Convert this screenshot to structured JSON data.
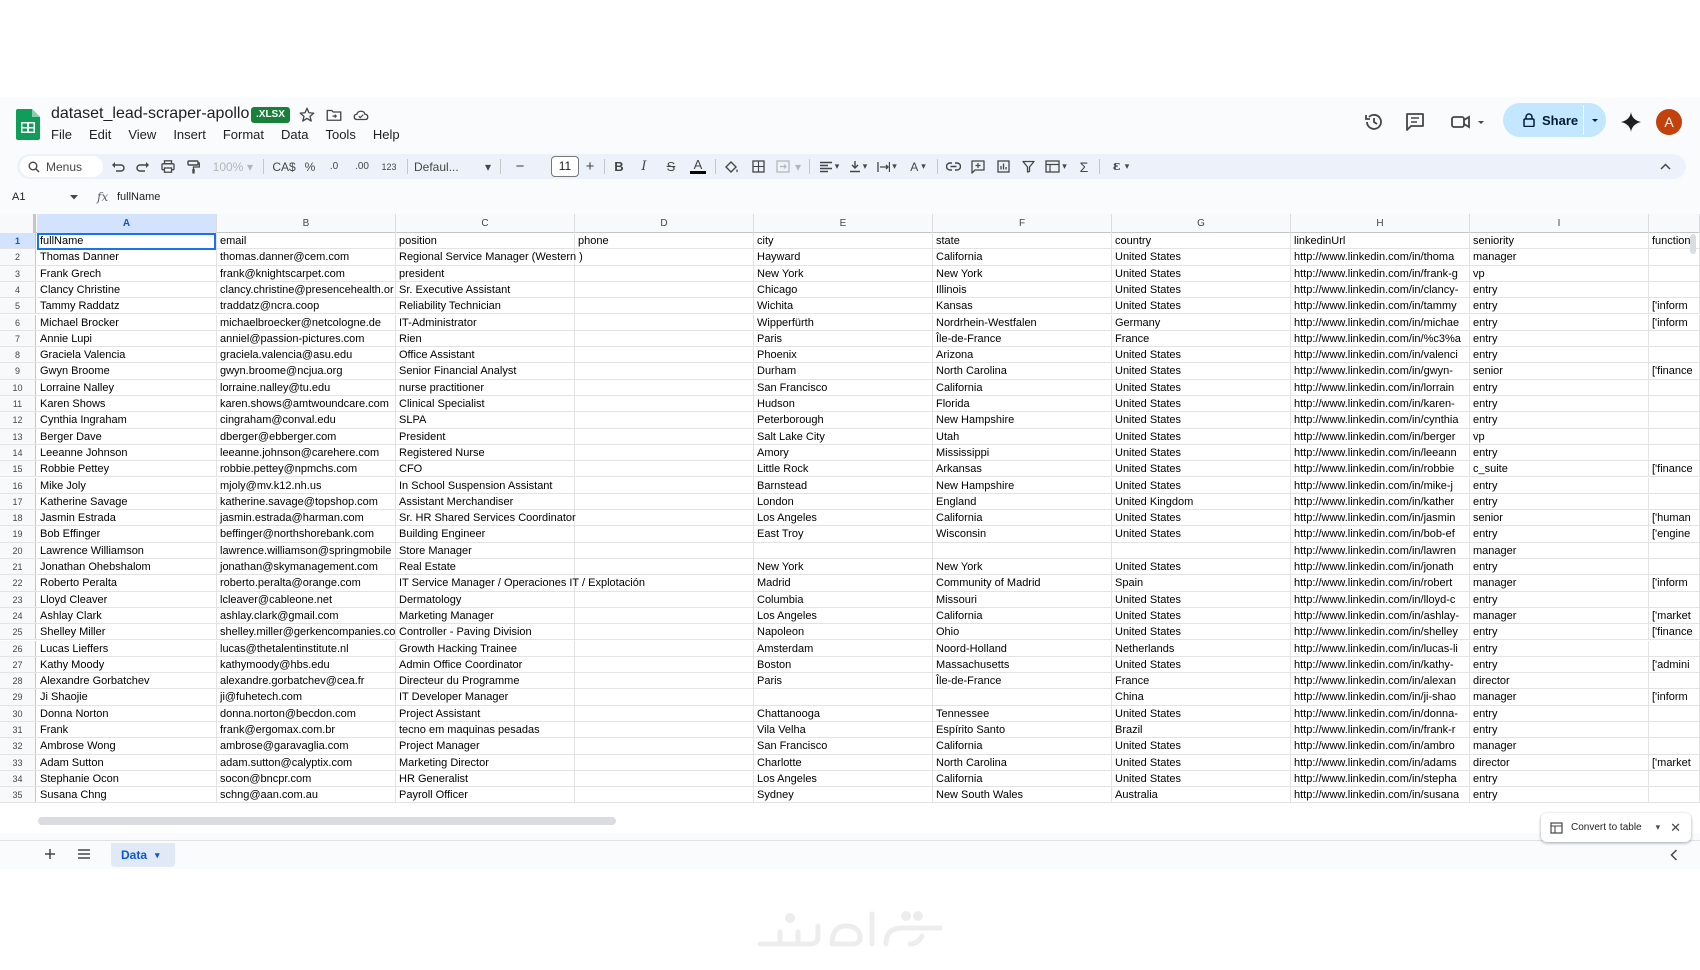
{
  "header": {
    "title": "dataset_lead-scraper-apollo",
    "badge": ".XLSX",
    "menu": [
      "File",
      "Edit",
      "View",
      "Insert",
      "Format",
      "Data",
      "Tools",
      "Help"
    ],
    "share_label": "Share",
    "avatar_initial": "A"
  },
  "toolbar": {
    "menus_label": "Menus",
    "zoom": "100%",
    "currency": "CA$",
    "percent": "%",
    "decrease_decimal": ".0",
    "increase_decimal": ".00",
    "number_format": "123",
    "font": "Defaul...",
    "font_size": "11"
  },
  "formula_bar": {
    "cell_ref": "A1",
    "fx": "fx",
    "content": "fullName"
  },
  "grid": {
    "columns": [
      "A",
      "B",
      "C",
      "D",
      "E",
      "F",
      "G",
      "H",
      "I",
      ""
    ],
    "rows": [
      [
        "1",
        "fullName",
        "email",
        "position",
        "phone",
        "city",
        "state",
        "country",
        "linkedinUrl",
        "seniority",
        "function"
      ],
      [
        "2",
        "Thomas Danner",
        "thomas.danner@cem.com",
        "Regional Service Manager (Western )",
        "",
        "Hayward",
        "California",
        "United States",
        "http://www.linkedin.com/in/thoma",
        "manager",
        ""
      ],
      [
        "3",
        "Frank Grech",
        "frank@knightscarpet.com",
        "president",
        "",
        "New York",
        "New York",
        "United States",
        "http://www.linkedin.com/in/frank-g",
        "vp",
        ""
      ],
      [
        "4",
        "Clancy Christine",
        "clancy.christine@presencehealth.or",
        "Sr. Executive Assistant",
        "",
        "Chicago",
        "Illinois",
        "United States",
        "http://www.linkedin.com/in/clancy-",
        "entry",
        ""
      ],
      [
        "5",
        "Tammy Raddatz",
        "traddatz@ncra.coop",
        "Reliability Technician",
        "",
        "Wichita",
        "Kansas",
        "United States",
        "http://www.linkedin.com/in/tammy",
        "entry",
        "['inform"
      ],
      [
        "6",
        "Michael Brocker",
        "michaelbroecker@netcologne.de",
        "IT-Administrator",
        "",
        "Wipperfürth",
        "Nordrhein-Westfalen",
        "Germany",
        "http://www.linkedin.com/in/michae",
        "entry",
        "['inform"
      ],
      [
        "7",
        "Annie Lupi",
        "anniel@passion-pictures.com",
        "Rien",
        "",
        "Paris",
        "Île-de-France",
        "France",
        "http://www.linkedin.com/in/%c3%a",
        "entry",
        ""
      ],
      [
        "8",
        "Graciela Valencia",
        "graciela.valencia@asu.edu",
        "Office Assistant",
        "",
        "Phoenix",
        "Arizona",
        "United States",
        "http://www.linkedin.com/in/valenci",
        "entry",
        ""
      ],
      [
        "9",
        "Gwyn Broome",
        "gwyn.broome@ncjua.org",
        "Senior Financial Analyst",
        "",
        "Durham",
        "North Carolina",
        "United States",
        "http://www.linkedin.com/in/gwyn-",
        "senior",
        "['finance"
      ],
      [
        "10",
        "Lorraine Nalley",
        "lorraine.nalley@tu.edu",
        "nurse practitioner",
        "",
        "San Francisco",
        "California",
        "United States",
        "http://www.linkedin.com/in/lorrain",
        "entry",
        ""
      ],
      [
        "11",
        "Karen Shows",
        "karen.shows@amtwoundcare.com",
        "Clinical Specialist",
        "",
        "Hudson",
        "Florida",
        "United States",
        "http://www.linkedin.com/in/karen-",
        "entry",
        ""
      ],
      [
        "12",
        "Cynthia Ingraham",
        "cingraham@conval.edu",
        "SLPA",
        "",
        "Peterborough",
        "New Hampshire",
        "United States",
        "http://www.linkedin.com/in/cynthia",
        "entry",
        ""
      ],
      [
        "13",
        "Berger Dave",
        "dberger@ebberger.com",
        "President",
        "",
        "Salt Lake City",
        "Utah",
        "United States",
        "http://www.linkedin.com/in/berger",
        "vp",
        ""
      ],
      [
        "14",
        "Leeanne Johnson",
        "leeanne.johnson@carehere.com",
        "Registered Nurse",
        "",
        "Amory",
        "Mississippi",
        "United States",
        "http://www.linkedin.com/in/leeann",
        "entry",
        ""
      ],
      [
        "15",
        "Robbie Pettey",
        "robbie.pettey@npmchs.com",
        "CFO",
        "",
        "Little Rock",
        "Arkansas",
        "United States",
        "http://www.linkedin.com/in/robbie",
        "c_suite",
        "['finance"
      ],
      [
        "16",
        "Mike Joly",
        "mjoly@mv.k12.nh.us",
        "In School Suspension Assistant",
        "",
        "Barnstead",
        "New Hampshire",
        "United States",
        "http://www.linkedin.com/in/mike-j",
        "entry",
        ""
      ],
      [
        "17",
        "Katherine Savage",
        "katherine.savage@topshop.com",
        "Assistant Merchandiser",
        "",
        "London",
        "England",
        "United Kingdom",
        "http://www.linkedin.com/in/kather",
        "entry",
        ""
      ],
      [
        "18",
        "Jasmin Estrada",
        "jasmin.estrada@harman.com",
        "Sr. HR Shared Services Coordinator",
        "",
        "Los Angeles",
        "California",
        "United States",
        "http://www.linkedin.com/in/jasmin",
        "senior",
        "['human"
      ],
      [
        "19",
        "Bob Effinger",
        "beffinger@northshorebank.com",
        "Building Engineer",
        "",
        "East Troy",
        "Wisconsin",
        "United States",
        "http://www.linkedin.com/in/bob-ef",
        "entry",
        "['engine"
      ],
      [
        "20",
        "Lawrence Williamson",
        "lawrence.williamson@springmobile",
        "Store Manager",
        "",
        "",
        "",
        "",
        "http://www.linkedin.com/in/lawren",
        "manager",
        ""
      ],
      [
        "21",
        "Jonathan Ohebshalom",
        "jonathan@skymanagement.com",
        "Real Estate",
        "",
        "New York",
        "New York",
        "United States",
        "http://www.linkedin.com/in/jonath",
        "entry",
        ""
      ],
      [
        "22",
        "Roberto Peralta",
        "roberto.peralta@orange.com",
        "IT Service Manager / Operaciones IT / Explotación",
        "",
        "Madrid",
        "Community of Madrid",
        "Spain",
        "http://www.linkedin.com/in/robert",
        "manager",
        "['inform"
      ],
      [
        "23",
        "Lloyd Cleaver",
        "lcleaver@cableone.net",
        "Dermatology",
        "",
        "Columbia",
        "Missouri",
        "United States",
        "http://www.linkedin.com/in/lloyd-c",
        "entry",
        ""
      ],
      [
        "24",
        "Ashlay Clark",
        "ashlay.clark@gmail.com",
        "Marketing Manager",
        "",
        "Los Angeles",
        "California",
        "United States",
        "http://www.linkedin.com/in/ashlay-",
        "manager",
        "['market"
      ],
      [
        "25",
        "Shelley Miller",
        "shelley.miller@gerkencompanies.co",
        "Controller - Paving Division",
        "",
        "Napoleon",
        "Ohio",
        "United States",
        "http://www.linkedin.com/in/shelley",
        "entry",
        "['finance"
      ],
      [
        "26",
        "Lucas Lieffers",
        "lucas@thetalentinstitute.nl",
        "Growth Hacking Trainee",
        "",
        "Amsterdam",
        "Noord-Holland",
        "Netherlands",
        "http://www.linkedin.com/in/lucas-li",
        "entry",
        ""
      ],
      [
        "27",
        "Kathy Moody",
        "kathymoody@hbs.edu",
        "Admin Office Coordinator",
        "",
        "Boston",
        "Massachusetts",
        "United States",
        "http://www.linkedin.com/in/kathy-",
        "entry",
        "['admini"
      ],
      [
        "28",
        "Alexandre Gorbatchev",
        "alexandre.gorbatchev@cea.fr",
        "Directeur du Programme",
        "",
        "Paris",
        "Île-de-France",
        "France",
        "http://www.linkedin.com/in/alexan",
        "director",
        ""
      ],
      [
        "29",
        "Ji Shaojie",
        "ji@fuhetech.com",
        "IT Developer Manager",
        "",
        "",
        "",
        "China",
        "http://www.linkedin.com/in/ji-shao",
        "manager",
        "['inform"
      ],
      [
        "30",
        "Donna Norton",
        "donna.norton@becdon.com",
        "Project Assistant",
        "",
        "Chattanooga",
        "Tennessee",
        "United States",
        "http://www.linkedin.com/in/donna-",
        "entry",
        ""
      ],
      [
        "31",
        "Frank",
        "frank@ergomax.com.br",
        "tecno em maquinas pesadas",
        "",
        "Vila Velha",
        "Espírito Santo",
        "Brazil",
        "http://www.linkedin.com/in/frank-r",
        "entry",
        ""
      ],
      [
        "32",
        "Ambrose Wong",
        "ambrose@garavaglia.com",
        "Project Manager",
        "",
        "San Francisco",
        "California",
        "United States",
        "http://www.linkedin.com/in/ambro",
        "manager",
        ""
      ],
      [
        "33",
        "Adam Sutton",
        "adam.sutton@calyptix.com",
        "Marketing Director",
        "",
        "Charlotte",
        "North Carolina",
        "United States",
        "http://www.linkedin.com/in/adams",
        "director",
        "['market"
      ],
      [
        "34",
        "Stephanie Ocon",
        "socon@bncpr.com",
        "HR Generalist",
        "",
        "Los Angeles",
        "California",
        "United States",
        "http://www.linkedin.com/in/stepha",
        "entry",
        ""
      ],
      [
        "35",
        "Susana Chng",
        "schng@aan.com.au",
        "Payroll Officer",
        "",
        "Sydney",
        "New South Wales",
        "Australia",
        "http://www.linkedin.com/in/susana",
        "entry",
        ""
      ]
    ]
  },
  "convert_chip": {
    "label": "Convert to table"
  },
  "sheet_tabs": [
    {
      "label": "Data"
    }
  ],
  "colors": {
    "accent": "#1a73e8",
    "share_bg": "#c2e7ff",
    "badge": "#188038",
    "avatar": "#c2410c"
  }
}
